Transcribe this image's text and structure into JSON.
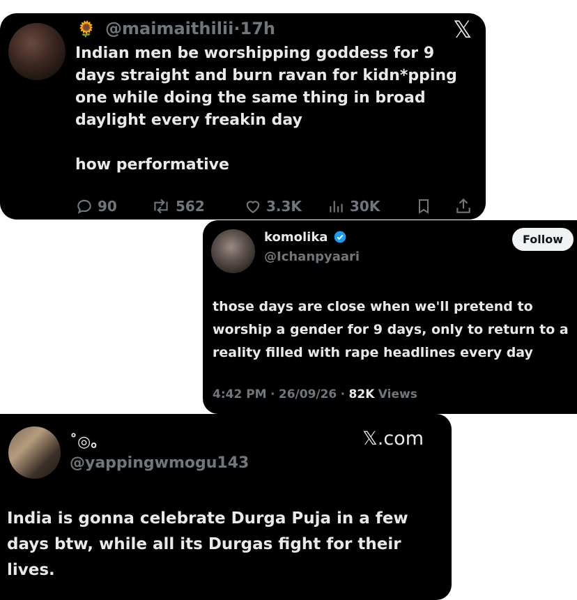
{
  "tweet1": {
    "emoji": "🌻",
    "handle": "@maimaithilii",
    "separator": "·",
    "time": "17h",
    "brand": "𝕏",
    "body": "Indian men be worshipping goddess for 9 days straight and burn ravan for kidn*pping one while doing the same thing in broad daylight every freakin day\n\nhow performative",
    "stats": {
      "replies": "90",
      "reposts": "562",
      "likes": "3.3K",
      "views": "30K"
    }
  },
  "tweet2": {
    "display_name": "komolika",
    "handle": "@Ichanpyaari",
    "follow_label": "Follow",
    "body": "those days are close when we'll pretend to worship a gender for 9 days, only to return to a reality filled with rape headlines every day",
    "time": "4:42 PM",
    "date": "26/09/26",
    "dot": "·",
    "views_count": "82K",
    "views_label": "Views",
    "verified_color": "#1d9bf0"
  },
  "tweet3": {
    "display_name": "˚◎。",
    "handle": "@yappingwmogu143",
    "brand": "𝕏.com",
    "body": "India is gonna celebrate Durga Puja in a few days btw, while all its Durgas fight for their lives."
  }
}
